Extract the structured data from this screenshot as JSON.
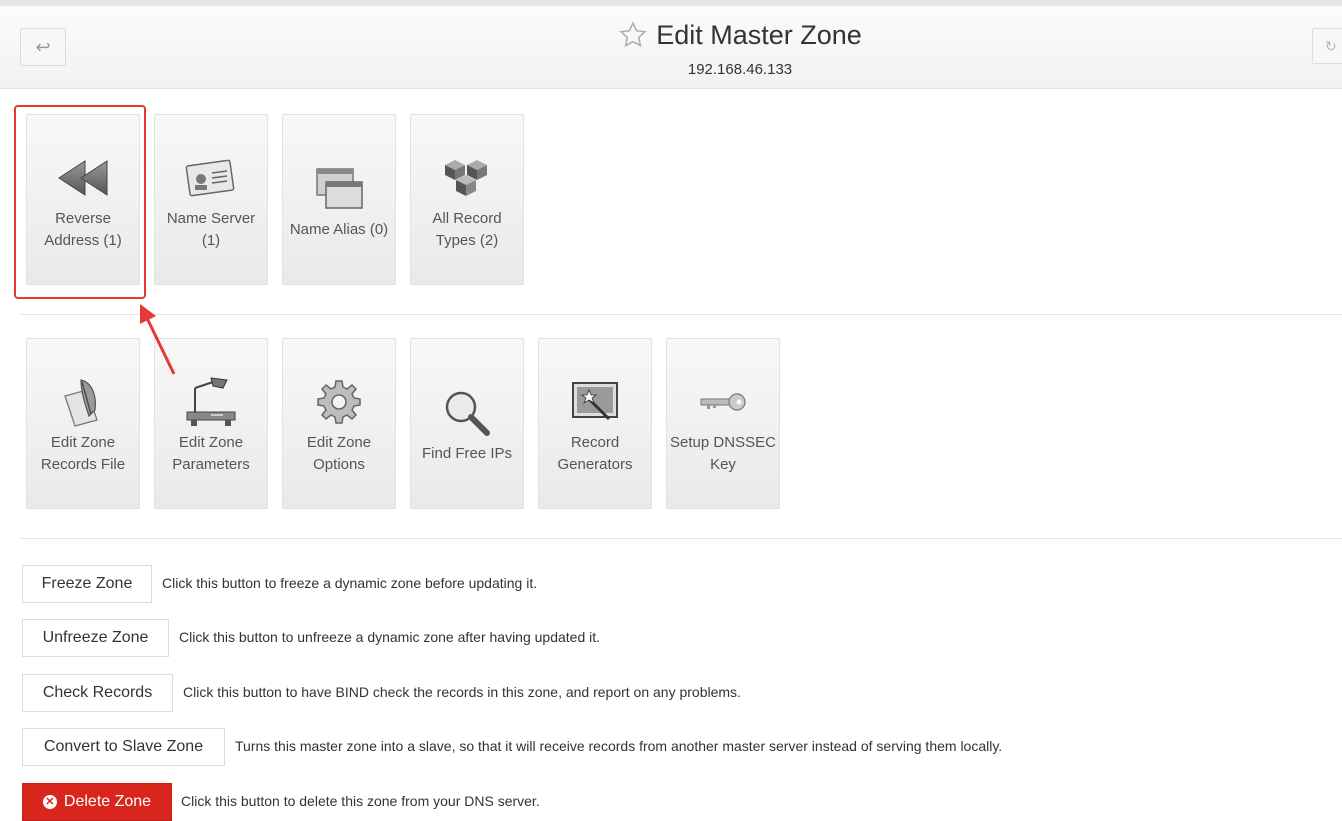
{
  "header": {
    "title": "Edit Master Zone",
    "subtitle": "192.168.46.133",
    "back_icon": "return-arrow-icon",
    "refresh_icon": "refresh-icon",
    "favorite_icon": "star-outline-icon"
  },
  "record_tiles": [
    {
      "label": "Reverse Address (1)",
      "icon": "rewind-icon"
    },
    {
      "label": "Name Server (1)",
      "icon": "id-card-icon"
    },
    {
      "label": "Name Alias (0)",
      "icon": "windows-icon"
    },
    {
      "label": "All Record Types (2)",
      "icon": "cubes-icon"
    }
  ],
  "action_tiles": [
    {
      "label": "Edit Zone Records File",
      "icon": "quill-paper-icon"
    },
    {
      "label": "Edit Zone Parameters",
      "icon": "desk-lamp-icon"
    },
    {
      "label": "Edit Zone Options",
      "icon": "gear-icon"
    },
    {
      "label": "Find Free IPs",
      "icon": "magnifier-icon"
    },
    {
      "label": "Record Generators",
      "icon": "magic-wand-screen-icon"
    },
    {
      "label": "Setup DNSSEC Key",
      "icon": "key-icon"
    }
  ],
  "actions": [
    {
      "label": "Freeze Zone",
      "description": "Click this button to freeze a dynamic zone before updating it."
    },
    {
      "label": "Unfreeze Zone",
      "description": "Click this button to unfreeze a dynamic zone after having updated it."
    },
    {
      "label": "Check Records",
      "description": "Click this button to have BIND check the records in this zone, and report on any problems."
    },
    {
      "label": "Convert to Slave Zone",
      "description": "Turns this master zone into a slave, so that it will receive records from another master server instead of serving them locally."
    },
    {
      "label": "Delete Zone",
      "description": "Click this button to delete this zone from your DNS server."
    }
  ],
  "colors": {
    "danger": "#d9261c",
    "annotation": "#e53935"
  }
}
